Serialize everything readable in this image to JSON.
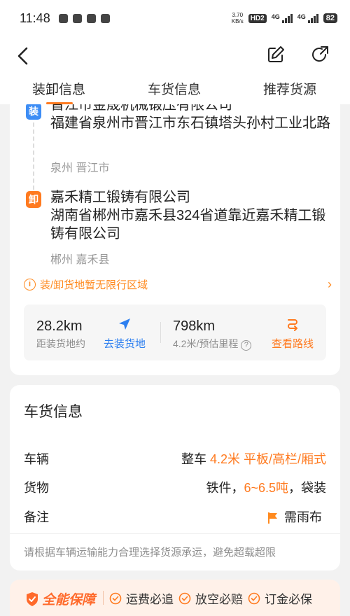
{
  "status_bar": {
    "time": "11:48",
    "net_speed_value": "3.70",
    "net_speed_unit": "KB/s",
    "hd_badge": "HD2",
    "net_1": "4G",
    "net_2": "4G",
    "battery": "82"
  },
  "tabs": [
    {
      "label": "装卸信息"
    },
    {
      "label": "车货信息"
    },
    {
      "label": "推荐货源"
    }
  ],
  "loading": {
    "badge": "装",
    "company": "晋江市金晟机械锻压有限公司",
    "address": "福建省泉州市晋江市东石镇塔头孙村工业北路",
    "city": "泉州 晋江市"
  },
  "unloading": {
    "badge": "卸",
    "company": "嘉禾精工锻铸有限公司",
    "address": "湖南省郴州市嘉禾县324省道靠近嘉禾精工锻铸有限公司",
    "city": "郴州 嘉禾县"
  },
  "notice": {
    "icon_text": "i",
    "text": "装/卸货地暂无限行区域"
  },
  "distance": {
    "to_pickup_value": "28.2km",
    "to_pickup_label": "距装货地约",
    "goto_label": "去装货地",
    "route_value": "798km",
    "route_label": "4.2米/预估里程",
    "route_help": "?",
    "route_action": "查看路线"
  },
  "cargo": {
    "title": "车货信息",
    "vehicle_label": "车辆",
    "vehicle_type": "整车",
    "vehicle_spec": "4.2米 平板/高栏/厢式",
    "goods_label": "货物",
    "goods_name": "铁件，",
    "goods_weight": "6~6.5吨",
    "goods_pack": "，袋装",
    "remark_label": "备注",
    "remark_value": "需雨布",
    "hint": "请根据车辆运输能力合理选择货源承运，避免超载超限"
  },
  "guarantee": {
    "brand": "全能保障",
    "items": [
      "运费必追",
      "放空必赔",
      "订金必保"
    ]
  },
  "colors": {
    "accent": "#ff7a1f",
    "blue": "#2d7ff0",
    "load_badge": "#3d8df5"
  }
}
